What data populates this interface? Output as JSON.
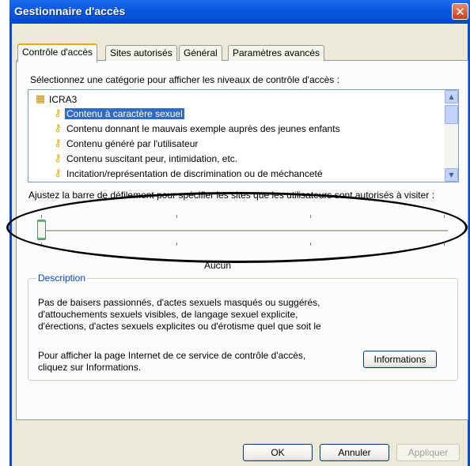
{
  "window": {
    "title": "Gestionnaire d'accès",
    "close_glyph": "✕"
  },
  "tabs": [
    {
      "label": "Contrôle d'accès",
      "active": true
    },
    {
      "label": "Sites autorisés"
    },
    {
      "label": "Général"
    },
    {
      "label": "Paramètres avancés"
    }
  ],
  "category": {
    "prompt": "Sélectionnez une catégorie pour afficher les niveaux de contrôle d'accès :",
    "root": "ICRA3",
    "items": [
      "Contenu à caractère sexuel",
      "Contenu donnant le mauvais exemple auprès des jeunes enfants",
      "Contenu généré par l'utilisateur",
      "Contenu suscitant peur, intimidation, etc.",
      "Incitation/représentation de discrimination ou de méchanceté"
    ],
    "selected_index": 0
  },
  "slider": {
    "prompt": "Ajustez la barre de défilement pour spécifier les sites que les utilisateurs sont autorisés à visiter :",
    "level_label": "Aucun",
    "position_fraction": 0
  },
  "description": {
    "legend": "Description",
    "lines": [
      "Pas de baisers passionnés, d'actes sexuels masqués ou suggérés,",
      "d'attouchements sexuels visibles, de langage sexuel explicite,",
      "d'érections, d'actes sexuels explicites ou d'érotisme quel que soit le"
    ],
    "info_lines": [
      "Pour afficher la page Internet de ce service de contrôle d'accès,",
      "cliquez sur Informations."
    ],
    "info_button": "Informations"
  },
  "buttons": {
    "ok": "OK",
    "cancel": "Annuler",
    "apply": "Appliquer"
  },
  "colors": {
    "titlebar": "#0a58e0",
    "dialog_bg": "#ece9d8",
    "selection": "#316ac5",
    "legend": "#0046d5"
  },
  "icons": {
    "root": "ratings-icon",
    "item": "key-icon"
  }
}
